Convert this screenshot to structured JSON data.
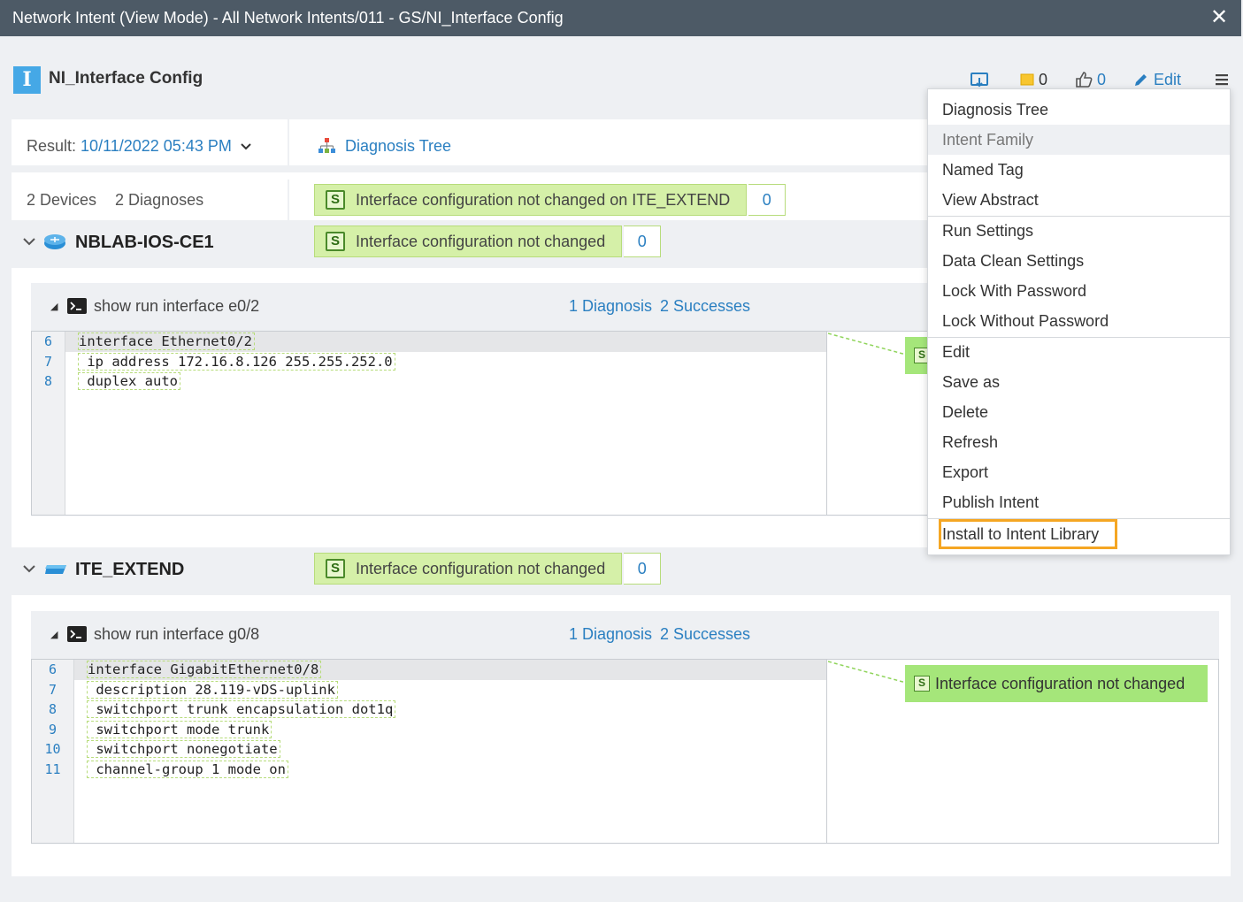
{
  "window": {
    "title": "Network Intent (View Mode) - All Network Intents/011 - GS/NI_Interface Config",
    "close_label": "✕"
  },
  "header": {
    "logo_letter": "I",
    "intent_name": "NI_Interface Config",
    "toolbar": {
      "notes_count": "0",
      "likes_count": "0",
      "edit_label": "Edit"
    }
  },
  "result": {
    "label": "Result:",
    "date": "10/11/2022 05:43 PM",
    "diagnosis_tree_label": "Diagnosis Tree"
  },
  "summary": {
    "devices": "2 Devices",
    "diagnoses": "2 Diagnoses",
    "top_badge": {
      "icon": "S",
      "text": "Interface configuration not changed on ITE_EXTEND",
      "count": "0"
    }
  },
  "devices": [
    {
      "name": "NBLAB-IOS-CE1",
      "badge": {
        "icon": "S",
        "text": "Interface configuration not changed",
        "count": "0"
      },
      "command": {
        "name": "show run interface e0/2",
        "diagnosis": "1 Diagnosis",
        "successes": "2 Successes",
        "lines": [
          {
            "num": "6",
            "text": "interface Ethernet0/2"
          },
          {
            "num": "7",
            "text": " ip address 172.16.8.126 255.255.252.0"
          },
          {
            "num": "8",
            "text": " duplex auto"
          }
        ],
        "result_tag": {
          "icon": "S",
          "text": ""
        }
      }
    },
    {
      "name": "ITE_EXTEND",
      "badge": {
        "icon": "S",
        "text": "Interface configuration not changed",
        "count": "0"
      },
      "command": {
        "name": "show run interface g0/8",
        "diagnosis": "1 Diagnosis",
        "successes": "2 Successes",
        "lines": [
          {
            "num": "6",
            "text": "interface GigabitEthernet0/8"
          },
          {
            "num": "7",
            "text": " description 28.119-vDS-uplink"
          },
          {
            "num": "8",
            "text": " switchport trunk encapsulation dot1q"
          },
          {
            "num": "9",
            "text": " switchport mode trunk"
          },
          {
            "num": "10",
            "text": " switchport nonegotiate"
          },
          {
            "num": "11",
            "text": " channel-group 1 mode on"
          }
        ],
        "result_tag": {
          "icon": "S",
          "text": "Interface configuration not changed"
        }
      }
    }
  ],
  "menu": {
    "items": [
      "Diagnosis Tree",
      "Intent Family",
      "Named Tag",
      "View Abstract",
      "Run Settings",
      "Data Clean Settings",
      "Lock With Password",
      "Lock Without Password",
      "Edit",
      "Save as",
      "Delete",
      "Refresh",
      "Export",
      "Publish Intent",
      "Install to Intent Library"
    ],
    "hovered": "Intent Family",
    "highlighted": "Install to Intent Library"
  },
  "colors": {
    "titlebar": "#4d5a66",
    "accent": "#2a7fc1",
    "success_badge": "#d5f0a8",
    "result_tag": "#a5e67a",
    "highlight_outline": "#f5a623"
  }
}
